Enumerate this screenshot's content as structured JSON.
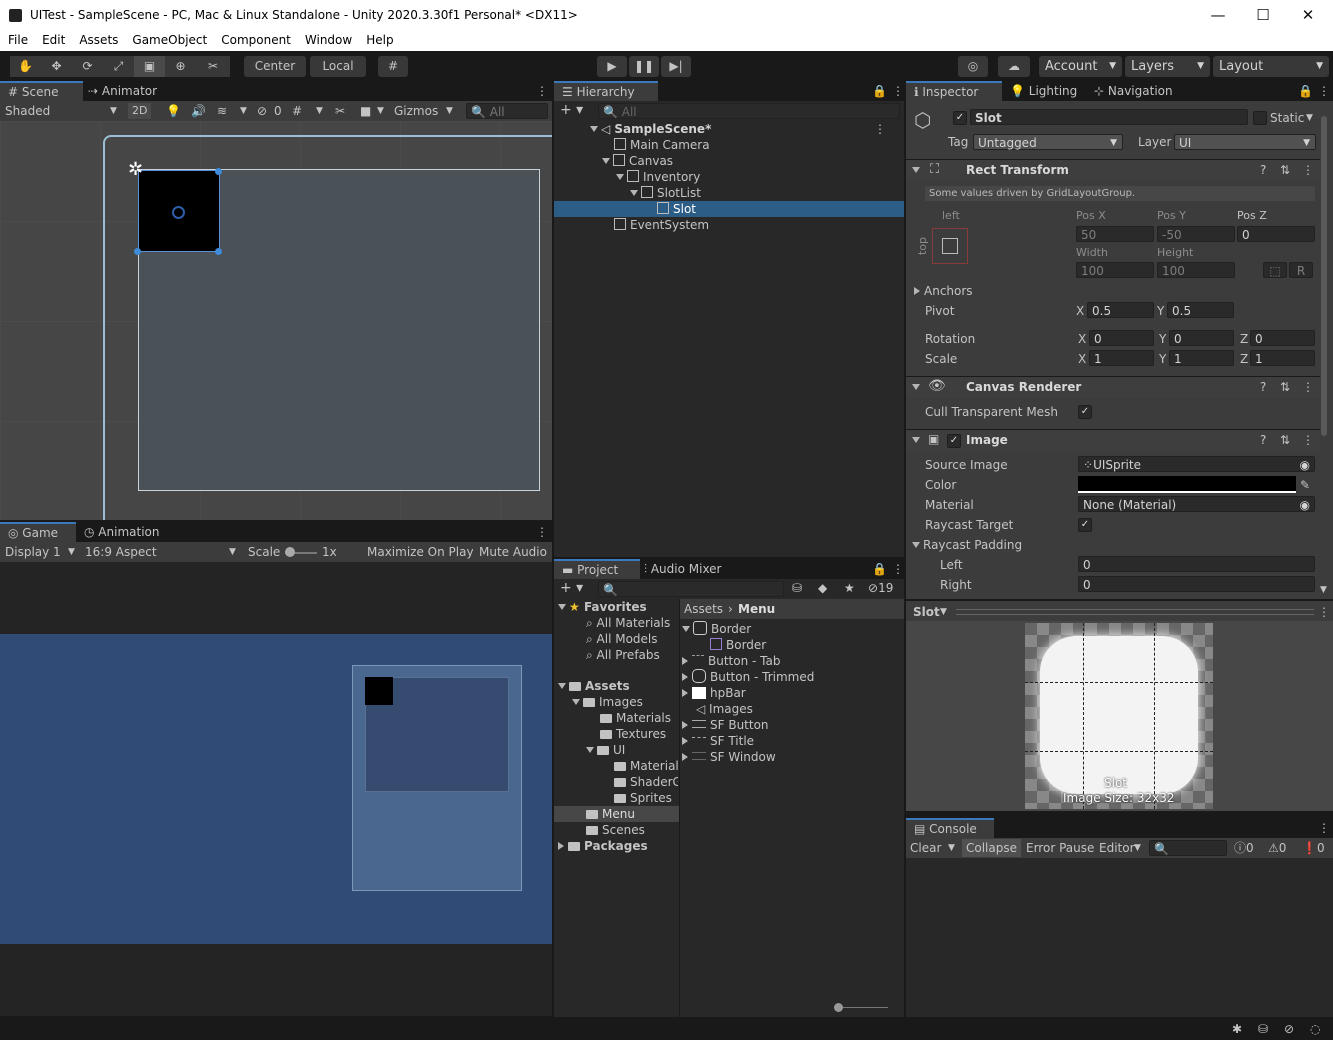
{
  "window": {
    "title": "UITest - SampleScene - PC, Mac & Linux Standalone - Unity 2020.3.30f1 Personal* <DX11>",
    "min": "—",
    "max": "☐",
    "close": "✕"
  },
  "menu": [
    "File",
    "Edit",
    "Assets",
    "GameObject",
    "Component",
    "Window",
    "Help"
  ],
  "toolbar": {
    "center": "Center",
    "local": "Local",
    "account": "Account",
    "layers": "Layers",
    "layout": "Layout"
  },
  "scene": {
    "tabs": [
      "Scene",
      "Animator"
    ],
    "shading": "Shaded",
    "mode2d": "2D",
    "hidden_count": "0",
    "gizmos": "Gizmos",
    "search_placeholder": "All"
  },
  "game": {
    "tabs": [
      "Game",
      "Animation"
    ],
    "display": "Display 1",
    "aspect": "16:9 Aspect",
    "scale_label": "Scale",
    "scale_value": "1x",
    "maximize": "Maximize On Play",
    "mute": "Mute Audio"
  },
  "hierarchy": {
    "tab": "Hierarchy",
    "search_placeholder": "All",
    "scene": "SampleScene*",
    "items": [
      "Main Camera",
      "Canvas",
      "Inventory",
      "SlotList",
      "Slot",
      "EventSystem"
    ]
  },
  "project": {
    "tabs": [
      "Project",
      "Audio Mixer"
    ],
    "hidden_count": "19",
    "favorites": "Favorites",
    "fav_items": [
      "All Materials",
      "All Models",
      "All Prefabs"
    ],
    "assets": "Assets",
    "tree": [
      "Images",
      "Materials",
      "Textures",
      "UI",
      "Materials",
      "ShaderG",
      "Sprites",
      "Menu",
      "Scenes"
    ],
    "packages": "Packages",
    "breadcrumb": [
      "Assets",
      "Menu"
    ],
    "files": [
      "Border",
      "Border",
      "Button - Tab",
      "Button - Trimmed",
      "hpBar",
      "Images",
      "SF Button",
      "SF Title",
      "SF Window"
    ]
  },
  "inspector": {
    "tabs": [
      "Inspector",
      "Lighting",
      "Navigation"
    ],
    "name": "Slot",
    "static": "Static",
    "tag_label": "Tag",
    "tag": "Untagged",
    "layer_label": "Layer",
    "layer": "UI",
    "rect": {
      "title": "Rect Transform",
      "note": "Some values driven by GridLayoutGroup.",
      "left": "left",
      "top": "top",
      "posx_l": "Pos X",
      "posy_l": "Pos Y",
      "posz_l": "Pos Z",
      "posx": "50",
      "posy": "-50",
      "posz": "0",
      "width_l": "Width",
      "height_l": "Height",
      "width": "100",
      "height": "100",
      "r": "R",
      "anchors": "Anchors",
      "pivot_l": "Pivot",
      "pivot_x": "0.5",
      "pivot_y": "0.5",
      "rotation_l": "Rotation",
      "rot_x": "0",
      "rot_y": "0",
      "rot_z": "0",
      "scale_l": "Scale",
      "scale_x": "1",
      "scale_y": "1",
      "scale_z": "1",
      "x": "X",
      "y": "Y",
      "z": "Z"
    },
    "canvas_renderer": {
      "title": "Canvas Renderer",
      "cull": "Cull Transparent Mesh"
    },
    "image": {
      "title": "Image",
      "source_l": "Source Image",
      "source": "UISprite",
      "color_l": "Color",
      "material_l": "Material",
      "material": "None (Material)",
      "raycast_target": "Raycast Target",
      "raycast_padding": "Raycast Padding",
      "left_l": "Left",
      "left": "0",
      "right_l": "Right",
      "right": "0"
    },
    "preview": {
      "name": "Slot",
      "caption1": "Slot",
      "caption2": "Image Size: 32x32"
    }
  },
  "console": {
    "tab": "Console",
    "clear": "Clear",
    "collapse": "Collapse",
    "error_pause": "Error Pause",
    "editor": "Editor",
    "counts": [
      "0",
      "0",
      "0"
    ]
  }
}
